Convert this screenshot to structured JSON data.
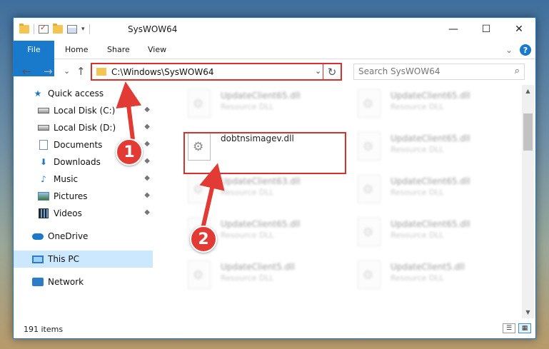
{
  "window": {
    "title": "SysWOW64",
    "buttons": {
      "minimize": "—",
      "maximize": "☐",
      "close": "✕"
    }
  },
  "ribbon": {
    "tabs": [
      "File",
      "Home",
      "Share",
      "View"
    ],
    "help": "?",
    "collapse": "⌄"
  },
  "nav": {
    "back": "←",
    "forward": "→",
    "recent": "⌄",
    "up": "↑",
    "address": "C:\\Windows\\SysWOW64",
    "address_dropdown": "⌄",
    "refresh": "↻",
    "search_placeholder": "Search SysWOW64",
    "search_icon": "⌕"
  },
  "sidebar": {
    "items": [
      {
        "label": "Quick access",
        "icon": "star-icon"
      },
      {
        "label": "Local Disk (C:)",
        "icon": "drive-icon",
        "pinned": true
      },
      {
        "label": "Local Disk (D:)",
        "icon": "drive-icon",
        "pinned": true
      },
      {
        "label": "Documents",
        "icon": "documents-icon",
        "pinned": true
      },
      {
        "label": "Downloads",
        "icon": "downloads-icon",
        "pinned": true
      },
      {
        "label": "Music",
        "icon": "music-icon",
        "pinned": true
      },
      {
        "label": "Pictures",
        "icon": "pictures-icon",
        "pinned": true
      },
      {
        "label": "Videos",
        "icon": "videos-icon",
        "pinned": true
      },
      {
        "label": "OneDrive",
        "icon": "onedrive-icon"
      },
      {
        "label": "This PC",
        "icon": "this-pc-icon",
        "selected": true
      },
      {
        "label": "Network",
        "icon": "network-icon"
      }
    ],
    "pin_glyph": "📌"
  },
  "files": [
    {
      "name": "UpdateClient65.dll",
      "type": "Resource DLL"
    },
    {
      "name": "UpdateClient65.dll",
      "type": "Resource DLL"
    },
    {
      "name": "dobtnsimagev.dll",
      "type": ""
    },
    {
      "name": "UpdateClient65.dll",
      "type": "Resource DLL"
    },
    {
      "name": "UpdateClient63.dll",
      "type": "Resource DLL"
    },
    {
      "name": "UpdateClient65.dll",
      "type": "Resource DLL"
    },
    {
      "name": "UpdateClient65.dll",
      "type": "Resource DLL"
    },
    {
      "name": "UpdateClient65.dll",
      "type": "Resource DLL"
    },
    {
      "name": "UpdateClient5.dll",
      "type": "Resource DLL"
    },
    {
      "name": "UpdateClient5.dll",
      "type": "Resource DLL"
    }
  ],
  "status": {
    "item_count": "191 items"
  },
  "callouts": {
    "step1": "1",
    "step2": "2"
  },
  "colors": {
    "accent": "#1979ca",
    "highlight": "#d9302c",
    "badge": "#e23b35",
    "selected": "#cce8ff"
  }
}
